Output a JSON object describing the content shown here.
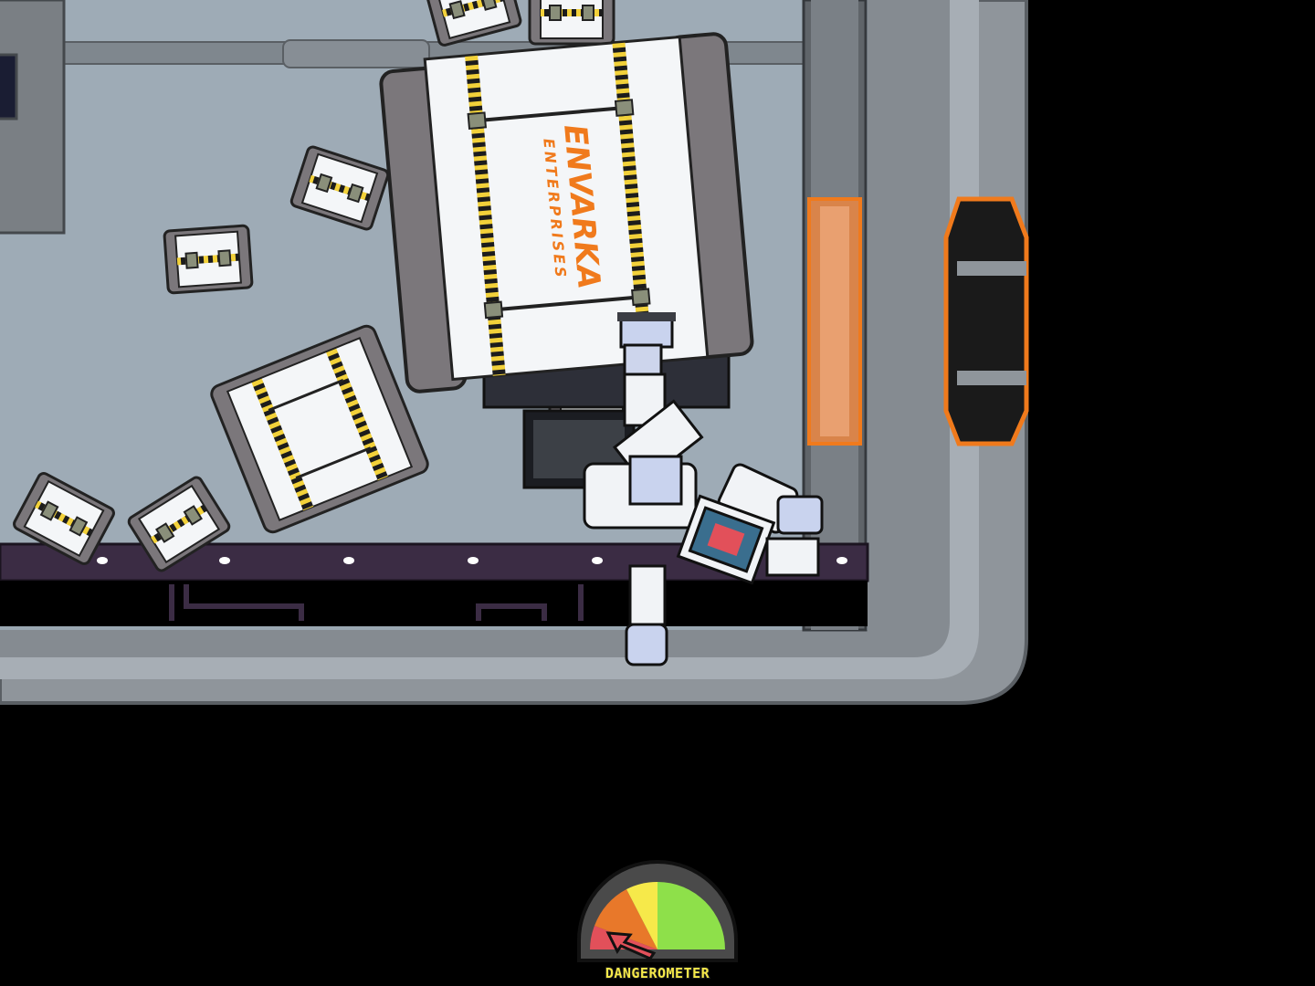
{
  "game": {
    "hud": {
      "meter_label": "DANGEROMETER",
      "meter_level": "low",
      "meter_colors": [
        "#e2505a",
        "#e8782a",
        "#f6e94a",
        "#8ee04a"
      ]
    },
    "cargo": {
      "logo_line1": "ENVARKA",
      "logo_line2": "ENTERPRISES"
    },
    "colors": {
      "background": "#000000",
      "floor": "#9aa7b2",
      "hull": "#8f959b",
      "hull_dark": "#5f6469",
      "crate": "#f4f6f8",
      "crate_side": "#7b777b",
      "hazard_yellow": "#f2d13a",
      "accent_orange": "#f07a1c",
      "conveyor": "#3b2c44"
    },
    "icons": [
      "astronaut-icon",
      "crate-icon",
      "airlock-door-icon",
      "dangerometer-gauge-icon",
      "arrow-icon"
    ]
  }
}
